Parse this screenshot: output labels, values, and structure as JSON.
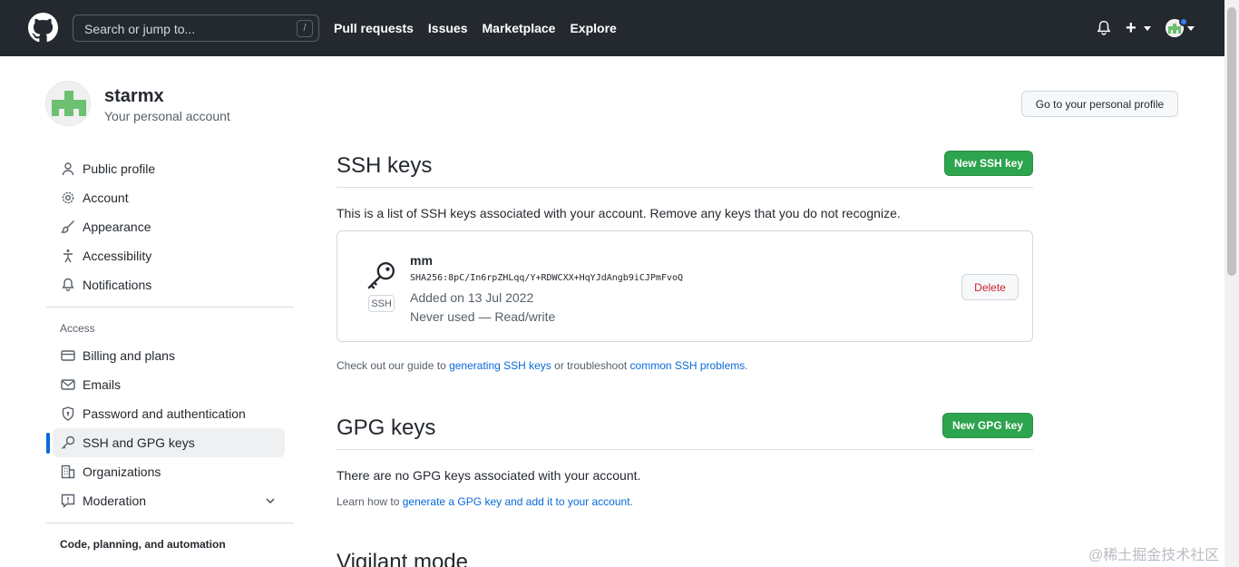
{
  "header": {
    "search_placeholder": "Search or jump to...",
    "slash_key": "/",
    "nav": [
      "Pull requests",
      "Issues",
      "Marketplace",
      "Explore"
    ],
    "plus_label": "+"
  },
  "profile": {
    "username": "starmx",
    "subtitle": "Your personal account",
    "profile_button": "Go to your personal profile"
  },
  "sidebar": {
    "items": [
      {
        "label": "Public profile"
      },
      {
        "label": "Account"
      },
      {
        "label": "Appearance"
      },
      {
        "label": "Accessibility"
      },
      {
        "label": "Notifications"
      }
    ],
    "access_heading": "Access",
    "access_items": [
      {
        "label": "Billing and plans"
      },
      {
        "label": "Emails"
      },
      {
        "label": "Password and authentication"
      },
      {
        "label": "SSH and GPG keys"
      },
      {
        "label": "Organizations"
      },
      {
        "label": "Moderation"
      }
    ],
    "code_heading": "Code, planning, and automation"
  },
  "ssh": {
    "title": "SSH keys",
    "new_button": "New SSH key",
    "description": "This is a list of SSH keys associated with your account. Remove any keys that you do not recognize.",
    "key": {
      "name": "mm",
      "fingerprint": "SHA256:8pC/In6rpZHLqq/Y+RDWCXX+HqYJdAngb9iCJPmFvoQ",
      "added": "Added on 13 Jul 2022",
      "usage": "Never used — Read/write",
      "type_label": "SSH",
      "delete_label": "Delete"
    },
    "guide_prefix": "Check out our guide to ",
    "guide_link1": "generating SSH keys",
    "guide_middle": " or troubleshoot ",
    "guide_link2": "common SSH problems",
    "guide_suffix": "."
  },
  "gpg": {
    "title": "GPG keys",
    "new_button": "New GPG key",
    "description": "There are no GPG keys associated with your account.",
    "learn_prefix": "Learn how to ",
    "learn_link": "generate a GPG key and add it to your account",
    "learn_suffix": "."
  },
  "vigilant": {
    "title": "Vigilant mode"
  },
  "watermark": "@稀土掘金技术社区",
  "colors": {
    "header_bg": "#24292f",
    "green": "#2da44e",
    "link": "#0969da",
    "danger": "#cf222e",
    "active_bar": "#0969da"
  }
}
